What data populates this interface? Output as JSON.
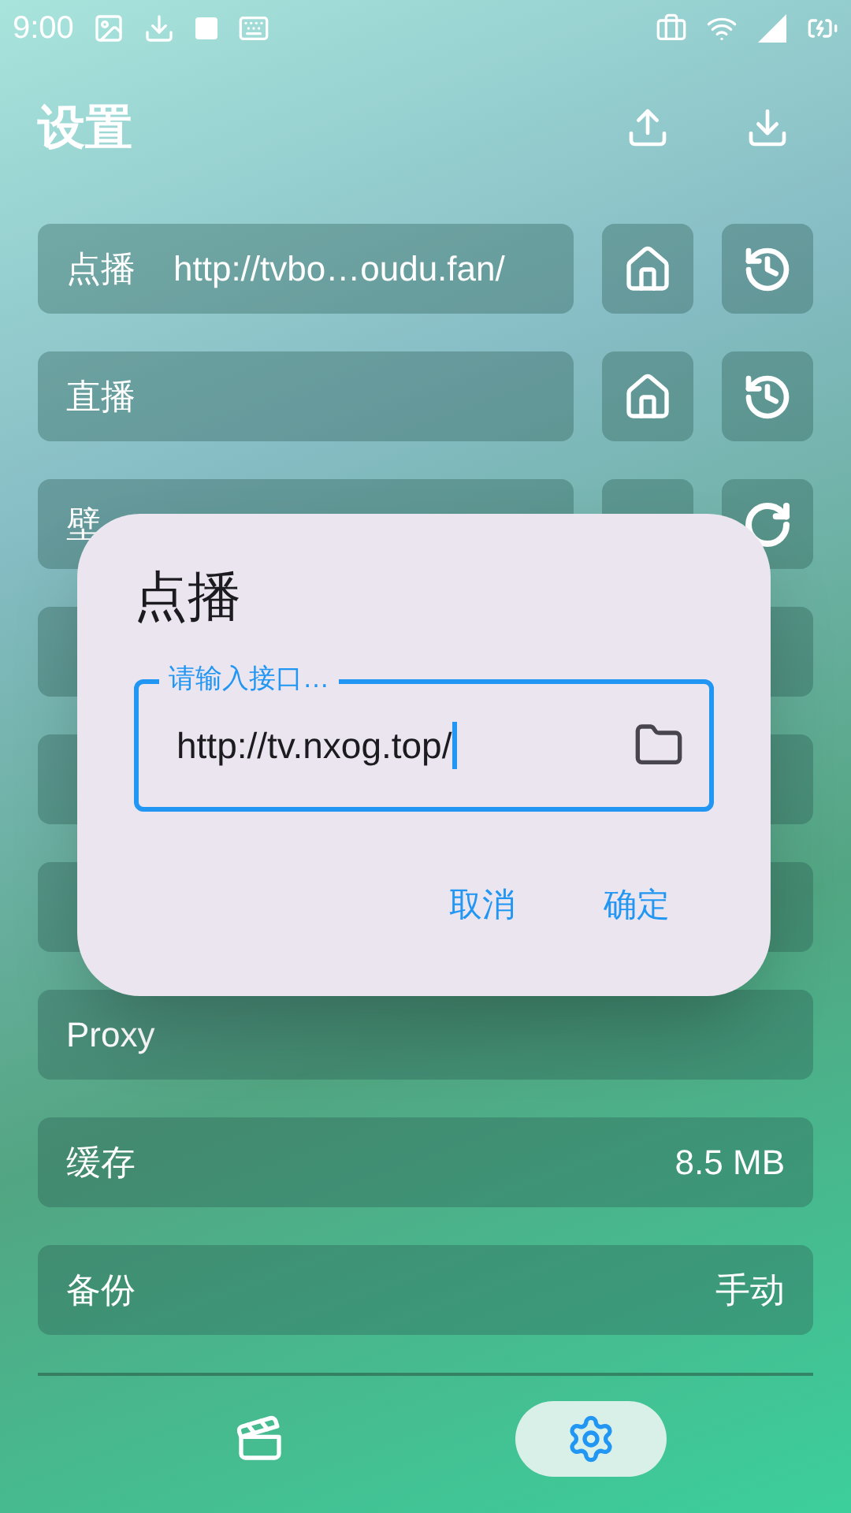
{
  "status_bar": {
    "time": "9:00"
  },
  "header": {
    "title": "设置"
  },
  "rows": [
    {
      "kind": "buttons",
      "label": "点播",
      "value": "http://tvbo…oudu.fan/",
      "buttons": [
        {
          "kind": "home"
        },
        {
          "kind": "history"
        }
      ]
    },
    {
      "kind": "buttons",
      "label": "直播",
      "buttons": [
        {
          "kind": "home"
        },
        {
          "kind": "history"
        }
      ]
    },
    {
      "kind": "buttons",
      "label": "壁",
      "buttons": [
        {
          "kind": "covered"
        },
        {
          "kind": "refresh"
        }
      ]
    },
    {
      "kind": "buttons",
      "buttons": [
        {
          "kind": "covered"
        }
      ]
    },
    {
      "kind": "buttons",
      "buttons": [
        {
          "kind": "covered"
        }
      ]
    },
    {
      "kind": "plain"
    },
    {
      "kind": "plain",
      "label": "Proxy"
    },
    {
      "kind": "plain",
      "label": "缓存",
      "value": "8.5 MB"
    },
    {
      "kind": "plain",
      "label": "备份",
      "value": "手动"
    }
  ],
  "dialog": {
    "title": "点播",
    "field": {
      "label": "请输入接口…",
      "value": "http://tv.nxog.top/",
      "focused": true
    },
    "actions": [
      "取消",
      "确定"
    ]
  },
  "nav": [
    {
      "kind": "movie",
      "selected": false
    },
    {
      "kind": "settings",
      "selected": true
    }
  ]
}
